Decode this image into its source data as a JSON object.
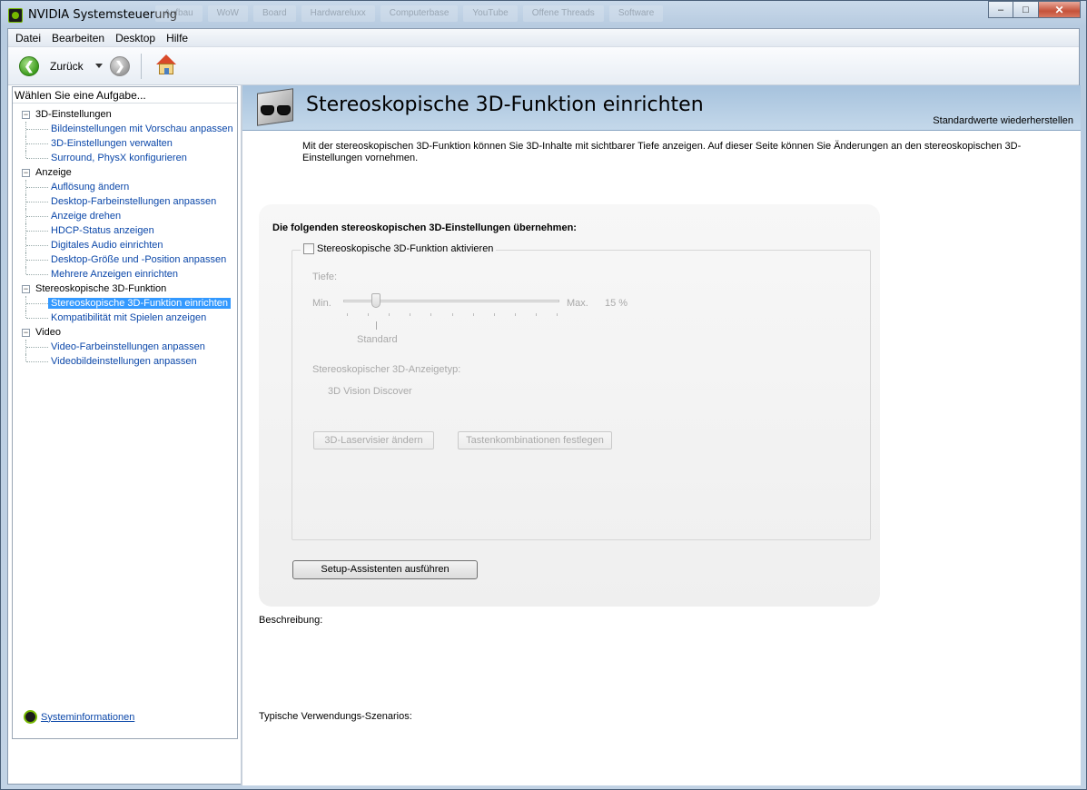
{
  "window": {
    "title": "NVIDIA Systemsteuerung",
    "background_tabs": [
      "Aufbau",
      "WoW",
      "Board",
      "Hardwareluxx",
      "Computerbase",
      "YouTube",
      "Offene Threads",
      "Software"
    ],
    "controls": {
      "minimize": "–",
      "maximize": "□",
      "close": "✕"
    }
  },
  "menu": [
    "Datei",
    "Bearbeiten",
    "Desktop",
    "Hilfe"
  ],
  "toolbar": {
    "back_label": "Zurück",
    "back_icon": "back-arrow-icon",
    "forward_icon": "forward-arrow-icon",
    "home_icon": "home-icon",
    "back_glyph": "❮",
    "forward_glyph": "❯"
  },
  "sidebar": {
    "header": "Wählen Sie eine Aufgabe...",
    "tree": [
      {
        "label": "3D-Einstellungen",
        "toggle": "−",
        "children": [
          "Bildeinstellungen mit Vorschau anpassen",
          "3D-Einstellungen verwalten",
          "Surround, PhysX konfigurieren"
        ]
      },
      {
        "label": "Anzeige",
        "toggle": "−",
        "children": [
          "Auflösung ändern",
          "Desktop-Farbeinstellungen anpassen",
          "Anzeige drehen",
          "HDCP-Status anzeigen",
          "Digitales Audio einrichten",
          "Desktop-Größe und -Position anpassen",
          "Mehrere Anzeigen einrichten"
        ]
      },
      {
        "label": "Stereoskopische 3D-Funktion",
        "toggle": "−",
        "children": [
          "Stereoskopische 3D-Funktion einrichten",
          "Kompatibilität mit Spielen anzeigen"
        ]
      },
      {
        "label": "Video",
        "toggle": "−",
        "children": [
          "Video-Farbeinstellungen anpassen",
          "Videobildeinstellungen anpassen"
        ]
      }
    ],
    "selected": "Stereoskopische 3D-Funktion einrichten",
    "sysinfo_link": "Systeminformationen"
  },
  "page": {
    "title": "Stereoskopische 3D-Funktion einrichten",
    "restore_defaults": "Standardwerte wiederherstellen",
    "intro": "Mit der stereoskopischen 3D-Funktion können Sie 3D-Inhalte mit sichtbarer Tiefe anzeigen. Auf dieser Seite können Sie Änderungen an den stereoskopischen 3D-Einstellungen vornehmen.",
    "panel_heading": "Die folgenden stereoskopischen 3D-Einstellungen übernehmen:",
    "enable_checkbox": {
      "label": "Stereoskopische 3D-Funktion aktivieren",
      "checked": false
    },
    "depth": {
      "label": "Tiefe:",
      "min_label": "Min.",
      "max_label": "Max.",
      "value_text": "15  %",
      "value_percent": 15,
      "default_label": "Standard"
    },
    "display_type_label": "Stereoskopischer 3D-Anzeigetyp:",
    "display_type_value": "3D Vision Discover",
    "btn_laser": "3D-Laservisier ändern",
    "btn_keys": "Tastenkombinationen festlegen",
    "btn_setup": "Setup-Assistenten ausführen",
    "description_label": "Beschreibung:",
    "usage_label": "Typische Verwendungs-Szenarios:"
  }
}
